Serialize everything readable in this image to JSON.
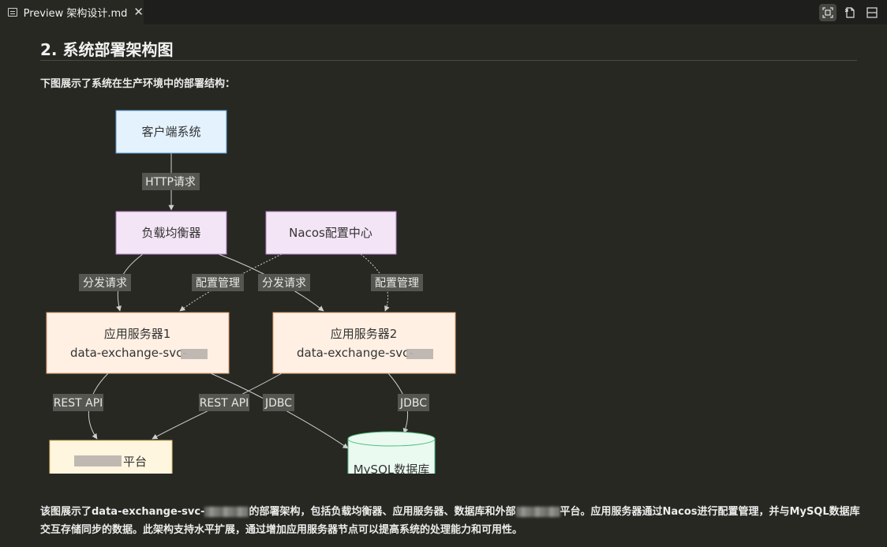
{
  "tab": {
    "title": "Preview 架构设计.md",
    "close_glyph": "✕"
  },
  "toolbar": {
    "icons": [
      "focus-frame-icon",
      "open-source-icon",
      "split-editor-icon"
    ]
  },
  "doc": {
    "heading": "2. 系统部署架构图",
    "intro": "下图展示了系统在生产环境中的部署结构：",
    "summary_part1": "该图展示了data-exchange-svc-",
    "summary_part2": "的部署架构，包括负载均衡器、应用服务器、数据库和外部",
    "summary_part3": "平台。应用服务器通过Nacos进行配置管理，并与MySQL数据库交互存储同步的数据。此架构支持水平扩展，通过增加应用服务器节点可以提高系统的处理能力和可用性。"
  },
  "diagram": {
    "nodes": {
      "client": "客户端系统",
      "lb": "负载均衡器",
      "nacos": "Nacos配置中心",
      "app1_title": "应用服务器1",
      "app1_sub": "data-exchange-svc-",
      "app2_title": "应用服务器2",
      "app2_sub": "data-exchange-svc-",
      "platform": "平台",
      "mysql": "MySQL数据库"
    },
    "edges": {
      "http": "HTTP请求",
      "dispatch1": "分发请求",
      "dispatch2": "分发请求",
      "config1": "配置管理",
      "config2": "配置管理",
      "rest1": "REST API",
      "rest2": "REST API",
      "jdbc1": "JDBC",
      "jdbc2": "JDBC"
    },
    "colors": {
      "client_fill": "#e3f2fd",
      "client_stroke": "#5b9bd5",
      "purple_fill": "#f3e5f5",
      "purple_stroke": "#b07cc6",
      "orange_fill": "#fff0e3",
      "orange_stroke": "#e0a070",
      "yellow_fill": "#fff6e0",
      "yellow_stroke": "#e6c36a",
      "db_fill": "#eafaf0",
      "db_stroke": "#4fbf7f",
      "edge": "#cfcfcf",
      "label_bg": "#55564f"
    }
  }
}
